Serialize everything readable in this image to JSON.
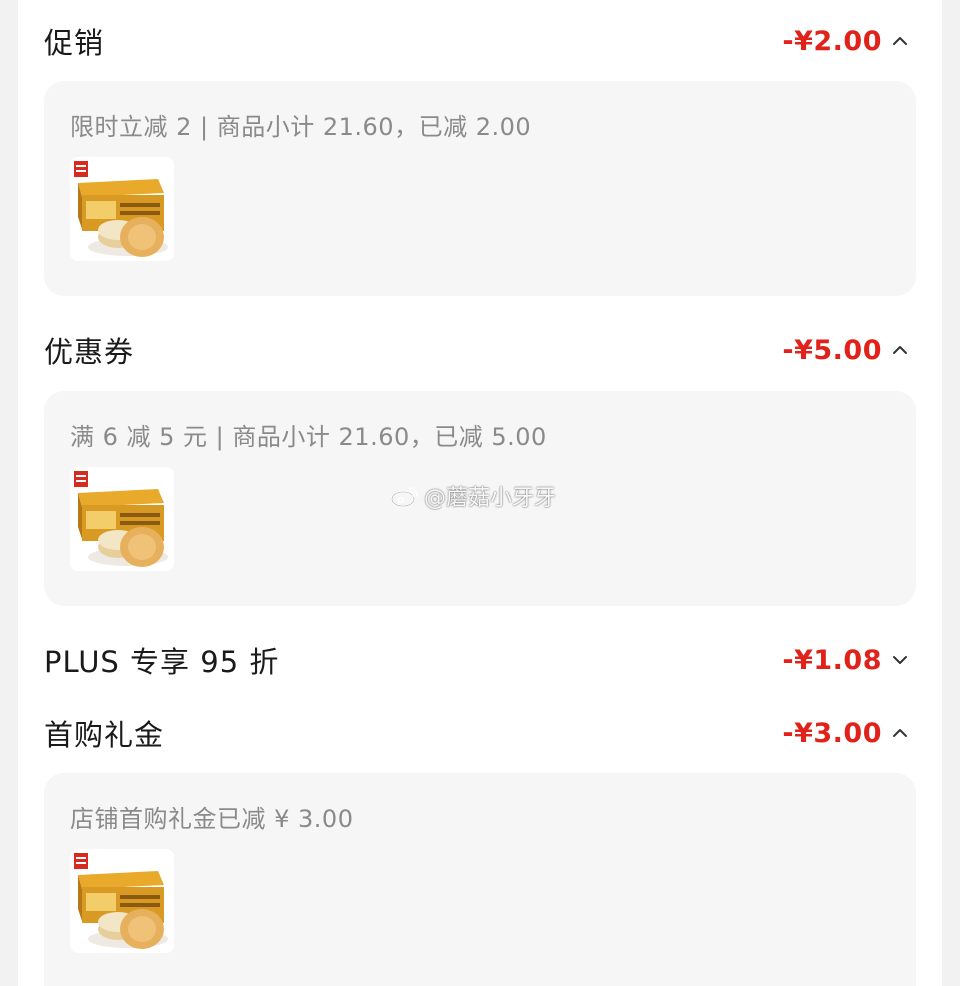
{
  "sections": [
    {
      "title": "促销",
      "amount": "-¥2.00",
      "expanded": true,
      "chevron": "chevron-up-icon",
      "detail": "限时立减 2 | 商品小计 21.60，已减 2.00",
      "product_image": "mooncake-gift-box"
    },
    {
      "title": "优惠券",
      "amount": "-¥5.00",
      "expanded": true,
      "chevron": "chevron-up-icon",
      "detail": "满 6 减 5 元 | 商品小计 21.60，已减 5.00",
      "product_image": "mooncake-gift-box"
    },
    {
      "title": "PLUS 专享 95 折",
      "amount": "-¥1.08",
      "expanded": false,
      "chevron": "chevron-down-icon"
    },
    {
      "title": "首购礼金",
      "amount": "-¥3.00",
      "expanded": true,
      "chevron": "chevron-up-icon",
      "detail": "店铺首购礼金已减 ¥ 3.00",
      "product_image": "mooncake-gift-box"
    }
  ],
  "watermark": {
    "text": "@蘑菇小牙牙",
    "icon": "weibo-icon"
  },
  "colors": {
    "accent_red": "#e0221a",
    "panel_bg": "#f6f6f6",
    "muted_text": "#8a8a8a"
  }
}
